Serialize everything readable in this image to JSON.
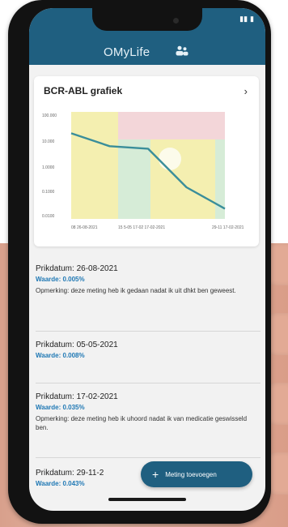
{
  "app": {
    "title": "OMyLife",
    "status": [
      "▮▮",
      "▮"
    ]
  },
  "card": {
    "title": "BCR-ABL grafiek"
  },
  "chart_data": {
    "type": "line",
    "yticks": [
      "100.000",
      "10.000",
      "1.0000",
      "0.1000",
      "0.0100"
    ],
    "xticks": [
      "08\n26-08-2021",
      "15  5-05  17-02\n17-02-2021",
      "29-11\n17-02-2021"
    ],
    "x": [
      0,
      0.25,
      0.5,
      0.75,
      1
    ],
    "y": [
      10.0,
      2.5,
      1.9,
      0.03,
      0.003
    ],
    "colors": {
      "line": "#3a8e9a",
      "yellow": "#f4efb0",
      "green": "#d6ecd7",
      "red": "#f3d6d9"
    }
  },
  "items": [
    {
      "date": "Prikdatum: 26-08-2021",
      "value": "Waarde: 0.005%",
      "note": "Opmerking: deze meting heb ik gedaan nadat ik uit dhkt ben geweest."
    },
    {
      "date": "Prikdatum: 05-05-2021",
      "value": "Waarde: 0.008%",
      "note": ""
    },
    {
      "date": "Prikdatum: 17-02-2021",
      "value": "Waarde: 0.035%",
      "note": "Opmerking: deze meting heb ik uhoord nadat ik van medicatie geswisseld ben."
    },
    {
      "date": "Prikdatum: 29-11-2",
      "value": "Waarde: 0.043%",
      "note": ""
    }
  ],
  "fab": {
    "label": "Meting toevoegen",
    "icon": "plus-icon"
  }
}
